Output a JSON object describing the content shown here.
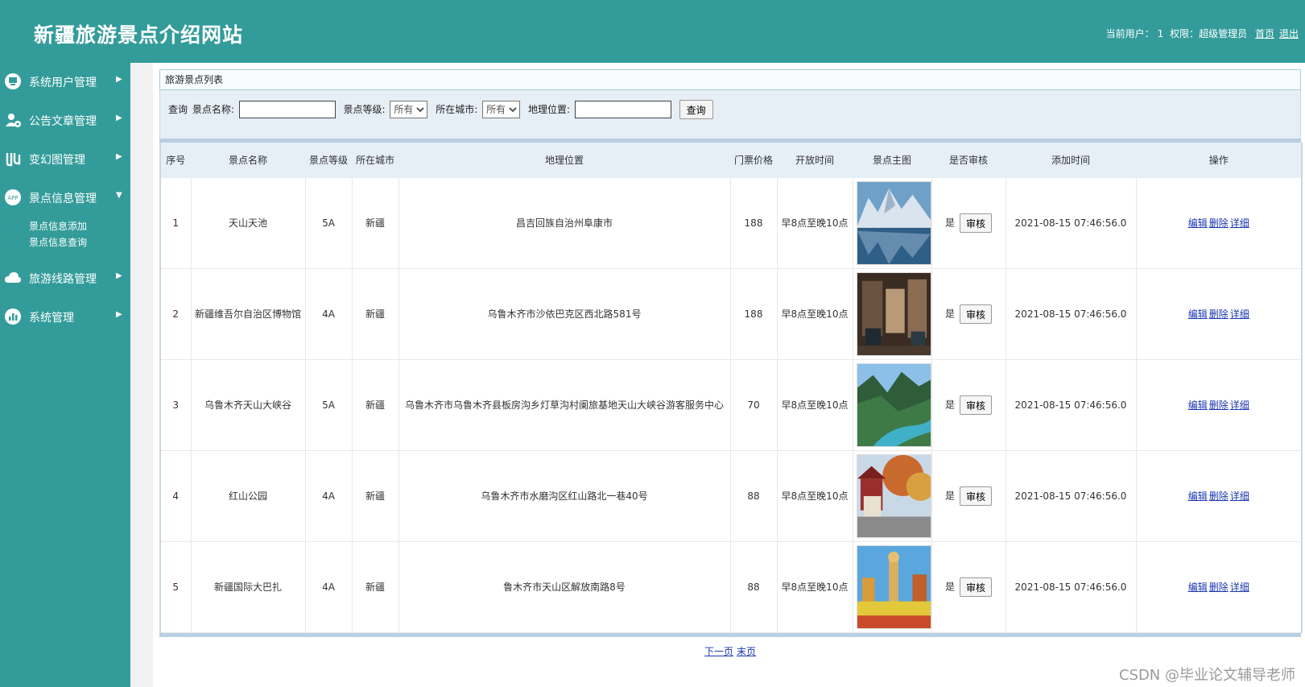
{
  "header": {
    "site_title": "新疆旅游景点介绍网站",
    "current_user_label": "当前用户：",
    "current_user": "1",
    "role_label": "权限：",
    "role": "超级管理员",
    "home_link": "首页",
    "logout_link": "退出"
  },
  "sidebar": {
    "items": [
      {
        "label": "系统用户管理",
        "icon": "monitor-icon",
        "arrow": "▶"
      },
      {
        "label": "公告文章管理",
        "icon": "user-gear-icon",
        "arrow": "▶"
      },
      {
        "label": "变幻图管理",
        "icon": "banner-icon",
        "arrow": "▶"
      },
      {
        "label": "景点信息管理",
        "icon": "app-icon",
        "arrow": "▼"
      },
      {
        "label": "旅游线路管理",
        "icon": "cloud-icon",
        "arrow": "▶"
      },
      {
        "label": "系统管理",
        "icon": "chart-icon",
        "arrow": "▶"
      }
    ],
    "subitems": [
      "景点信息添加",
      "景点信息查询"
    ]
  },
  "panel": {
    "title": "旅游景点列表"
  },
  "query": {
    "prefix": "查询",
    "name_label": "景点名称:",
    "name_value": "",
    "level_label": "景点等级:",
    "level_value": "所有",
    "city_label": "所在城市:",
    "city_value": "所有",
    "location_label": "地理位置:",
    "location_value": "",
    "submit": "查询"
  },
  "table": {
    "headers": {
      "no": "序号",
      "name": "景点名称",
      "level": "景点等级",
      "city": "所在城市",
      "location": "地理位置",
      "price": "门票价格",
      "hours": "开放时间",
      "image": "景点主图",
      "audited": "是否审核",
      "added": "添加时间",
      "actions": "操作"
    },
    "rows": [
      {
        "no": "1",
        "name": "天山天池",
        "level": "5A",
        "city": "新疆",
        "location": "昌吉回族自治州阜康市",
        "price": "188",
        "hours": "早8点至晚10点",
        "image": "snow-mountain-lake",
        "audited": "是",
        "audit_btn": "审核",
        "added": "2021-08-15 07:46:56.0",
        "edit": "编辑",
        "delete": "删除",
        "detail": "详细"
      },
      {
        "no": "2",
        "name": "新疆维吾尔自治区博物馆",
        "level": "4A",
        "city": "新疆",
        "location": "乌鲁木齐市沙依巴克区西北路581号",
        "price": "188",
        "hours": "早8点至晚10点",
        "image": "museum-interior",
        "audited": "是",
        "audit_btn": "审核",
        "added": "2021-08-15 07:46:56.0",
        "edit": "编辑",
        "delete": "删除",
        "detail": "详细"
      },
      {
        "no": "3",
        "name": "乌鲁木齐天山大峡谷",
        "level": "5A",
        "city": "新疆",
        "location": "乌鲁木齐市乌鲁木齐县板房沟乡灯草沟村阑旅基地天山大峡谷游客服务中心",
        "price": "70",
        "hours": "早8点至晚10点",
        "image": "valley-river",
        "audited": "是",
        "audit_btn": "审核",
        "added": "2021-08-15 07:46:56.0",
        "edit": "编辑",
        "delete": "删除",
        "detail": "详细"
      },
      {
        "no": "4",
        "name": "红山公园",
        "level": "4A",
        "city": "新疆",
        "location": "乌鲁木齐市水磨沟区红山路北一巷40号",
        "price": "88",
        "hours": "早8点至晚10点",
        "image": "park-autumn",
        "audited": "是",
        "audit_btn": "审核",
        "added": "2021-08-15 07:46:56.0",
        "edit": "编辑",
        "delete": "删除",
        "detail": "详细"
      },
      {
        "no": "5",
        "name": "新疆国际大巴扎",
        "level": "4A",
        "city": "新疆",
        "location": "鲁木齐市天山区解放南路8号",
        "price": "88",
        "hours": "早8点至晚10点",
        "image": "bazaar-tower",
        "audited": "是",
        "audit_btn": "审核",
        "added": "2021-08-15 07:46:56.0",
        "edit": "编辑",
        "delete": "删除",
        "detail": "详细"
      }
    ]
  },
  "pager": {
    "next": "下一页",
    "last": "末页"
  },
  "watermark": "CSDN @毕业论文辅导老师",
  "colors": {
    "brand": "#339c9a",
    "header_bg": "#e6eef6",
    "link": "#1a37b0"
  }
}
